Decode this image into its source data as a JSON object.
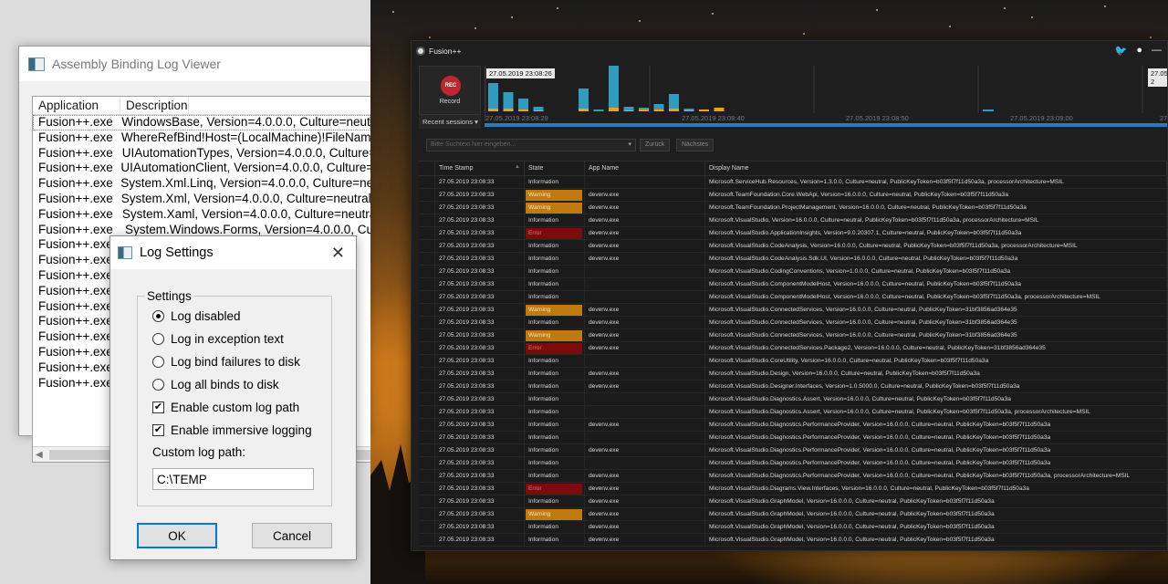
{
  "assembly_viewer": {
    "title": "Assembly Binding Log Viewer",
    "columns": [
      "Application",
      "Description"
    ],
    "rows": [
      {
        "app": "Fusion++.exe",
        "desc": "WindowsBase, Version=4.0.0.0, Culture=neutral"
      },
      {
        "app": "Fusion++.exe",
        "desc": "WhereRefBind!Host=(LocalMachine)!FileName="
      },
      {
        "app": "Fusion++.exe",
        "desc": "UIAutomationTypes, Version=4.0.0.0, Culture=n"
      },
      {
        "app": "Fusion++.exe",
        "desc": "UIAutomationClient, Version=4.0.0.0, Culture=ne"
      },
      {
        "app": "Fusion++.exe",
        "desc": "System.Xml.Linq, Version=4.0.0.0, Culture=neutr"
      },
      {
        "app": "Fusion++.exe",
        "desc": "System.Xml, Version=4.0.0.0, Culture=neutral, P"
      },
      {
        "app": "Fusion++.exe",
        "desc": "System.Xaml, Version=4.0.0.0, Culture=neutral,"
      },
      {
        "app": "Fusion++.exe",
        "desc": "System.Windows.Forms, Version=4.0.0.0, Cu"
      },
      {
        "app": "Fusion++.exe",
        "desc": ""
      },
      {
        "app": "Fusion++.exe",
        "desc": ""
      },
      {
        "app": "Fusion++.exe",
        "desc": ""
      },
      {
        "app": "Fusion++.exe",
        "desc": ""
      },
      {
        "app": "Fusion++.exe",
        "desc": ""
      },
      {
        "app": "Fusion++.exe",
        "desc": ""
      },
      {
        "app": "Fusion++.exe",
        "desc": ""
      },
      {
        "app": "Fusion++.exe",
        "desc": ""
      },
      {
        "app": "Fusion++.exe",
        "desc": ""
      },
      {
        "app": "Fusion++.exe",
        "desc": ""
      }
    ]
  },
  "log_settings": {
    "title": "Log Settings",
    "group_label": "Settings",
    "options": [
      {
        "label": "Log disabled",
        "type": "radio",
        "checked": true
      },
      {
        "label": "Log in exception text",
        "type": "radio",
        "checked": false
      },
      {
        "label": "Log bind failures to disk",
        "type": "radio",
        "checked": false
      },
      {
        "label": "Log all binds to disk",
        "type": "radio",
        "checked": false
      },
      {
        "label": "Enable custom log path",
        "type": "checkbox",
        "checked": true
      },
      {
        "label": "Enable immersive logging",
        "type": "checkbox",
        "checked": true
      }
    ],
    "custom_path_label": "Custom log path:",
    "custom_path_value": "C:\\TEMP",
    "ok_label": "OK",
    "cancel_label": "Cancel",
    "close_glyph": "✕",
    "check_glyph": "✔"
  },
  "fusion": {
    "title": "Fusion++",
    "record_label": "Record",
    "record_badge": "REC",
    "recent_sessions": "Recent sessions ▾",
    "timeline_stamp_left": "27.05.2019 23:08:26",
    "timeline_stamp_right": "27.05.2019 2",
    "axis_labels": [
      "27.05.2019 23:08:29",
      "27.05.2019 23:08:40",
      "27.05.2019 23:08:50",
      "27.05.2019 23:09:00",
      "27.0"
    ],
    "timeline_bars": [
      {
        "info": 28,
        "warn": 3
      },
      {
        "info": 18,
        "warn": 3
      },
      {
        "info": 12,
        "warn": 2
      },
      {
        "info": 4,
        "warn": 1
      },
      {
        "info": 0,
        "warn": 0
      },
      {
        "info": 0,
        "warn": 0
      },
      {
        "info": 22,
        "warn": 3
      },
      {
        "info": 2,
        "warn": 0
      },
      {
        "info": 50,
        "warn": 4
      },
      {
        "info": 4,
        "warn": 1
      },
      {
        "info": 2,
        "warn": 2
      },
      {
        "info": 6,
        "warn": 2
      },
      {
        "info": 16,
        "warn": 3
      },
      {
        "info": 2,
        "warn": 1
      },
      {
        "info": 0,
        "warn": 2
      },
      {
        "info": 0,
        "warn": 4
      }
    ],
    "search_placeholder": "Bitte Suchtext hier eingeben...",
    "btn_back": "Zurück",
    "btn_next": "Nächstes",
    "columns": [
      "Time Stamp",
      "State",
      "App Name",
      "Display Name"
    ],
    "rows": [
      {
        "time": "27.05.2019 23:08:33",
        "state": "Information",
        "app": "",
        "display": "Microsoft.ServiceHub.Resources, Version=1.3.0.0, Culture=neutral, PublicKeyToken=b03f5f7f11d50a3a, processorArchitecture=MSIL"
      },
      {
        "time": "27.05.2019 23:08:33",
        "state": "Warning",
        "app": "devenv.exe",
        "display": "Microsoft.TeamFoundation.Core.WebApi, Version=16.0.0.0, Culture=neutral, PublicKeyToken=b03f5f7f11d50a3a"
      },
      {
        "time": "27.05.2019 23:08:33",
        "state": "Warning",
        "app": "devenv.exe",
        "display": "Microsoft.TeamFoundation.ProjectManagement, Version=16.0.0.0, Culture=neutral, PublicKeyToken=b03f5f7f11d50a3a"
      },
      {
        "time": "27.05.2019 23:08:33",
        "state": "Information",
        "app": "devenv.exe",
        "display": "Microsoft.VisualStudio, Version=16.0.0.0, Culture=neutral, PublicKeyToken=b03f5f7f11d50a3a, processorArchitecture=MSIL"
      },
      {
        "time": "27.05.2019 23:08:33",
        "state": "Error",
        "app": "devenv.exe",
        "display": "Microsoft.VisualStudio.ApplicationInsights, Version=9.0.20307.1, Culture=neutral, PublicKeyToken=b03f5f7f11d50a3a"
      },
      {
        "time": "27.05.2019 23:08:33",
        "state": "Information",
        "app": "devenv.exe",
        "display": "Microsoft.VisualStudio.CodeAnalysis, Version=16.0.0.0, Culture=neutral, PublicKeyToken=b03f5f7f11d50a3a, processorArchitecture=MSIL"
      },
      {
        "time": "27.05.2019 23:08:33",
        "state": "Information",
        "app": "devenv.exe",
        "display": "Microsoft.VisualStudio.CodeAnalysis.Sdk.UI, Version=16.0.0.0, Culture=neutral, PublicKeyToken=b03f5f7f11d50a3a"
      },
      {
        "time": "27.05.2019 23:08:33",
        "state": "Information",
        "app": "",
        "display": "Microsoft.VisualStudio.CodingConventions, Version=1.0.0.0, Culture=neutral, PublicKeyToken=b03f5f7f11d50a3a"
      },
      {
        "time": "27.05.2019 23:08:33",
        "state": "Information",
        "app": "",
        "display": "Microsoft.VisualStudio.ComponentModelHost, Version=16.0.0.0, Culture=neutral, PublicKeyToken=b03f5f7f11d50a3a"
      },
      {
        "time": "27.05.2019 23:08:33",
        "state": "Information",
        "app": "",
        "display": "Microsoft.VisualStudio.ComponentModelHost, Version=16.0.0.0, Culture=neutral, PublicKeyToken=b03f5f7f11d50a3a, processorArchitecture=MSIL"
      },
      {
        "time": "27.05.2019 23:08:33",
        "state": "Warning",
        "app": "devenv.exe",
        "display": "Microsoft.VisualStudio.ConnectedServices, Version=16.0.0.0, Culture=neutral, PublicKeyToken=31bf3856ad364e35"
      },
      {
        "time": "27.05.2019 23:08:33",
        "state": "Information",
        "app": "devenv.exe",
        "display": "Microsoft.VisualStudio.ConnectedServices, Version=16.0.0.0, Culture=neutral, PublicKeyToken=31bf3856ad364e35"
      },
      {
        "time": "27.05.2019 23:08:33",
        "state": "Warning",
        "app": "devenv.exe",
        "display": "Microsoft.VisualStudio.ConnectedServices, Version=16.0.0.0, Culture=neutral, PublicKeyToken=31bf3856ad364e35"
      },
      {
        "time": "27.05.2019 23:08:33",
        "state": "Error",
        "app": "devenv.exe",
        "display": "Microsoft.VisualStudio.ConnectedServices.Package2, Version=16.0.0.0, Culture=neutral, PublicKeyToken=31bf3856ad364e35"
      },
      {
        "time": "27.05.2019 23:08:33",
        "state": "Information",
        "app": "",
        "display": "Microsoft.VisualStudio.CoreUtility, Version=16.0.0.0, Culture=neutral, PublicKeyToken=b03f5f7f11d50a3a"
      },
      {
        "time": "27.05.2019 23:08:33",
        "state": "Information",
        "app": "devenv.exe",
        "display": "Microsoft.VisualStudio.Design, Version=16.0.0.0, Culture=neutral, PublicKeyToken=b03f5f7f11d50a3a"
      },
      {
        "time": "27.05.2019 23:08:33",
        "state": "Information",
        "app": "devenv.exe",
        "display": "Microsoft.VisualStudio.Designer.Interfaces, Version=1.0.5000.0, Culture=neutral, PublicKeyToken=b03f5f7f11d50a3a"
      },
      {
        "time": "27.05.2019 23:08:33",
        "state": "Information",
        "app": "",
        "display": "Microsoft.VisualStudio.Diagnostics.Assert, Version=16.0.0.0, Culture=neutral, PublicKeyToken=b03f5f7f11d50a3a"
      },
      {
        "time": "27.05.2019 23:08:33",
        "state": "Information",
        "app": "",
        "display": "Microsoft.VisualStudio.Diagnostics.Assert, Version=16.0.0.0, Culture=neutral, PublicKeyToken=b03f5f7f11d50a3a, processorArchitecture=MSIL"
      },
      {
        "time": "27.05.2019 23:08:33",
        "state": "Information",
        "app": "devenv.exe",
        "display": "Microsoft.VisualStudio.Diagnostics.PerformanceProvider, Version=16.0.0.0, Culture=neutral, PublicKeyToken=b03f5f7f11d50a3a"
      },
      {
        "time": "27.05.2019 23:08:33",
        "state": "Information",
        "app": "",
        "display": "Microsoft.VisualStudio.Diagnostics.PerformanceProvider, Version=16.0.0.0, Culture=neutral, PublicKeyToken=b03f5f7f11d50a3a"
      },
      {
        "time": "27.05.2019 23:08:33",
        "state": "Information",
        "app": "devenv.exe",
        "display": "Microsoft.VisualStudio.Diagnostics.PerformanceProvider, Version=16.0.0.0, Culture=neutral, PublicKeyToken=b03f5f7f11d50a3a"
      },
      {
        "time": "27.05.2019 23:08:33",
        "state": "Information",
        "app": "",
        "display": "Microsoft.VisualStudio.Diagnostics.PerformanceProvider, Version=16.0.0.0, Culture=neutral, PublicKeyToken=b03f5f7f11d50a3a"
      },
      {
        "time": "27.05.2019 23:08:33",
        "state": "Information",
        "app": "devenv.exe",
        "display": "Microsoft.VisualStudio.Diagnostics.PerformanceProvider, Version=16.0.0.0, Culture=neutral, PublicKeyToken=b03f5f7f11d50a3a, processorArchitecture=MSIL"
      },
      {
        "time": "27.05.2019 23:08:33",
        "state": "Error",
        "app": "devenv.exe",
        "display": "Microsoft.VisualStudio.Diagrams.View.Interfaces, Version=16.0.0.0, Culture=neutral, PublicKeyToken=b03f5f7f11d50a3a"
      },
      {
        "time": "27.05.2019 23:08:33",
        "state": "Information",
        "app": "devenv.exe",
        "display": "Microsoft.VisualStudio.GraphModel, Version=16.0.0.0, Culture=neutral, PublicKeyToken=b03f5f7f11d50a3a"
      },
      {
        "time": "27.05.2019 23:08:33",
        "state": "Warning",
        "app": "devenv.exe",
        "display": "Microsoft.VisualStudio.GraphModel, Version=16.0.0.0, Culture=neutral, PublicKeyToken=b03f5f7f11d50a3a"
      },
      {
        "time": "27.05.2019 23:08:33",
        "state": "Information",
        "app": "devenv.exe",
        "display": "Microsoft.VisualStudio.GraphModel, Version=16.0.0.0, Culture=neutral, PublicKeyToken=b03f5f7f11d50a3a"
      },
      {
        "time": "27.05.2019 23:08:33",
        "state": "Information",
        "app": "devenv.exe",
        "display": "Microsoft.VisualStudio.GraphModel, Version=16.0.0.0, Culture=neutral, PublicKeyToken=b03f5f7f11d50a3a"
      }
    ]
  },
  "colors": {
    "info_bar": "#2e9bbf",
    "warn_bar": "#e8a317",
    "accent": "#2b7bb8"
  }
}
